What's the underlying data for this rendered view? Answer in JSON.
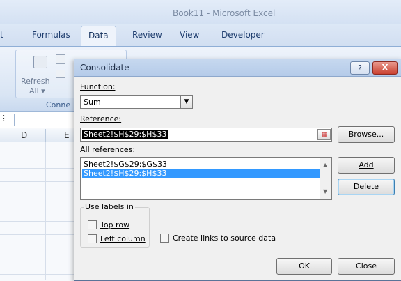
{
  "window": {
    "title": "Book11 - Microsoft Excel"
  },
  "ribbon": {
    "tabs": [
      {
        "label": "t"
      },
      {
        "label": "Formulas"
      },
      {
        "label": "Data"
      },
      {
        "label": "Review"
      },
      {
        "label": "View"
      },
      {
        "label": "Developer"
      }
    ],
    "active_tab": "Data",
    "refresh_label": "Refresh",
    "refresh_sub": "All ▾",
    "connections_group_label": "Conne"
  },
  "sheet": {
    "columns": [
      "D",
      "E"
    ]
  },
  "dialog": {
    "title": "Consolidate",
    "help_label": "?",
    "close_label": "X",
    "function_label": "Function:",
    "function_value": "Sum",
    "reference_label": "Reference:",
    "reference_value": "Sheet2!$H$29:$H$33",
    "browse_label": "Browse...",
    "all_references_label": "All references:",
    "all_references": [
      "Sheet2!$G$29:$G$33",
      "Sheet2!$H$29:$H$33"
    ],
    "selected_reference_index": 1,
    "add_label": "Add",
    "delete_label": "Delete",
    "use_labels_label": "Use labels in",
    "top_row_label": "Top row",
    "left_column_label": "Left column",
    "create_links_label": "Create links to source data",
    "ok_label": "OK",
    "close_button_label": "Close",
    "checkboxes": {
      "top_row": false,
      "left_column": false,
      "create_links": false
    }
  }
}
